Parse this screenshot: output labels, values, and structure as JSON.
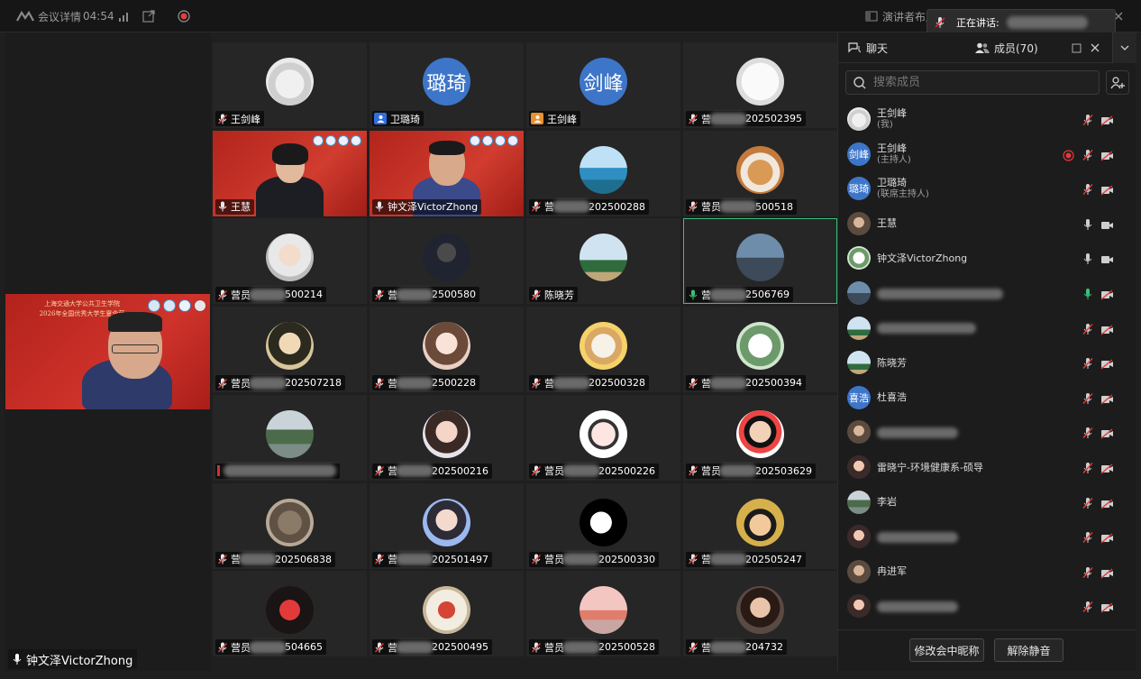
{
  "topbar": {
    "meeting_details": "会议详情",
    "timer": "04:54",
    "layout_label": "演讲者布局"
  },
  "speaking": {
    "label": "正在讲话:"
  },
  "main_video": {
    "name": "钟文泽VictorZhong",
    "slide_title_1": "上海交通大学公共卫生学院",
    "slide_title_2": "2026年全国优秀大学生夏令营"
  },
  "grid": [
    {
      "name": "王剑峰",
      "name_prefix": "",
      "name_suffix": "",
      "avatar_text": "",
      "avatar": "drawing",
      "mic": "muted"
    },
    {
      "name": "卫璐琦",
      "name_prefix": "",
      "name_suffix": "",
      "avatar_text": "璐琦",
      "avatar": "blue",
      "mic": "badge-blue"
    },
    {
      "name": "王剑峰",
      "name_prefix": "",
      "name_suffix": "",
      "avatar_text": "剑峰",
      "avatar": "blue",
      "mic": "badge-orange"
    },
    {
      "name": "",
      "name_prefix": "营",
      "name_suffix": "202502395",
      "avatar_text": "",
      "avatar": "sketch",
      "mic": "muted"
    },
    {
      "name": "王慧",
      "name_prefix": "",
      "name_suffix": "",
      "avatar_text": "",
      "avatar": "video",
      "mic": "on"
    },
    {
      "name": "钟文泽VictorZhong",
      "name_prefix": "",
      "name_suffix": "",
      "avatar_text": "",
      "avatar": "video",
      "mic": "on"
    },
    {
      "name": "",
      "name_prefix": "营",
      "name_suffix": "202500288",
      "avatar_text": "",
      "avatar": "sea",
      "mic": "muted"
    },
    {
      "name": "",
      "name_prefix": "营员",
      "name_suffix": "500518",
      "avatar_text": "",
      "avatar": "dog",
      "mic": "muted"
    },
    {
      "name": "",
      "name_prefix": "营员",
      "name_suffix": "500214",
      "avatar_text": "",
      "avatar": "girl",
      "mic": "muted"
    },
    {
      "name": "",
      "name_prefix": "营",
      "name_suffix": "2500580",
      "avatar_text": "",
      "avatar": "dark",
      "mic": "muted"
    },
    {
      "name": "陈晓芳",
      "name_prefix": "",
      "name_suffix": "",
      "avatar_text": "",
      "avatar": "palm",
      "mic": "muted"
    },
    {
      "name": "",
      "name_prefix": "营",
      "name_suffix": "2506769",
      "avatar_text": "",
      "avatar": "bridge",
      "mic": "on-green"
    },
    {
      "name": "",
      "name_prefix": "营员",
      "name_suffix": "202507218",
      "avatar_text": "",
      "avatar": "anime",
      "mic": "muted"
    },
    {
      "name": "",
      "name_prefix": "营",
      "name_suffix": "2500228",
      "avatar_text": "",
      "avatar": "anime2",
      "mic": "muted"
    },
    {
      "name": "",
      "name_prefix": "营",
      "name_suffix": "202500328",
      "avatar_text": "",
      "avatar": "puppy",
      "mic": "muted"
    },
    {
      "name": "",
      "name_prefix": "营",
      "name_suffix": "202500394",
      "avatar_text": "",
      "avatar": "cartoon",
      "mic": "muted"
    },
    {
      "name": "",
      "name_prefix": "",
      "name_suffix": "",
      "avatar_text": "",
      "avatar": "lake",
      "mic": "hidden"
    },
    {
      "name": "",
      "name_prefix": "营",
      "name_suffix": "202500216",
      "avatar_text": "",
      "avatar": "girl2",
      "mic": "muted"
    },
    {
      "name": "",
      "name_prefix": "营员",
      "name_suffix": "202500226",
      "avatar_text": "",
      "avatar": "grad",
      "mic": "muted"
    },
    {
      "name": "",
      "name_prefix": "营员",
      "name_suffix": "202503629",
      "avatar_text": "",
      "avatar": "melon",
      "mic": "muted"
    },
    {
      "name": "",
      "name_prefix": "营",
      "name_suffix": "202506838",
      "avatar_text": "",
      "avatar": "cat",
      "mic": "muted"
    },
    {
      "name": "",
      "name_prefix": "营",
      "name_suffix": "202501497",
      "avatar_text": "",
      "avatar": "girl3",
      "mic": "muted"
    },
    {
      "name": "",
      "name_prefix": "营员",
      "name_suffix": "202500330",
      "avatar_text": "",
      "avatar": "bw",
      "mic": "muted"
    },
    {
      "name": "",
      "name_prefix": "营",
      "name_suffix": "202505247",
      "avatar_text": "",
      "avatar": "luffy",
      "mic": "muted"
    },
    {
      "name": "",
      "name_prefix": "营员",
      "name_suffix": "504665",
      "avatar_text": "",
      "avatar": "red",
      "mic": "muted"
    },
    {
      "name": "",
      "name_prefix": "营",
      "name_suffix": "202500495",
      "avatar_text": "",
      "avatar": "mascot",
      "mic": "muted"
    },
    {
      "name": "",
      "name_prefix": "营员",
      "name_suffix": "202500528",
      "avatar_text": "",
      "avatar": "sunset",
      "mic": "muted"
    },
    {
      "name": "",
      "name_prefix": "营",
      "name_suffix": "204732",
      "avatar_text": "",
      "avatar": "woman",
      "mic": "muted"
    }
  ],
  "sidebar": {
    "tab_chat": "聊天",
    "tab_members": "成员(70)",
    "search_placeholder": "搜索成员",
    "members": [
      {
        "name": "王剑峰",
        "role": "(我)",
        "avatar_text": "",
        "avatar": "drawing",
        "mic": "muted",
        "cam": "off"
      },
      {
        "name": "王剑峰",
        "role": "(主持人)",
        "avatar_text": "剑峰",
        "avatar": "blue",
        "mic": "muted",
        "cam": "off",
        "recording": true
      },
      {
        "name": "卫璐琦",
        "role": "(联席主持人)",
        "avatar_text": "璐琦",
        "avatar": "blue",
        "mic": "muted",
        "cam": "off"
      },
      {
        "name": "王慧",
        "role": "",
        "avatar_text": "",
        "avatar": "photo",
        "mic": "on",
        "cam": "on"
      },
      {
        "name": "钟文泽VictorZhong",
        "role": "",
        "avatar_text": "",
        "avatar": "cartoon",
        "mic": "on",
        "cam": "on"
      },
      {
        "name": "",
        "role": "",
        "avatar_text": "",
        "avatar": "bridge",
        "mic": "on-green",
        "cam": "off"
      },
      {
        "name": "",
        "role": "",
        "avatar_text": "",
        "avatar": "palm",
        "mic": "muted",
        "cam": "off"
      },
      {
        "name": "陈晓芳",
        "role": "",
        "avatar_text": "",
        "avatar": "palm",
        "mic": "muted",
        "cam": "off"
      },
      {
        "name": "杜喜浩",
        "role": "",
        "avatar_text": "喜浩",
        "avatar": "blue",
        "mic": "muted",
        "cam": "off"
      },
      {
        "name": "",
        "role": "",
        "avatar_text": "",
        "avatar": "photo",
        "mic": "muted",
        "cam": "off"
      },
      {
        "name": "雷晓宁-环境健康系-硕导",
        "role": "",
        "avatar_text": "",
        "avatar": "photo2",
        "mic": "muted",
        "cam": "off"
      },
      {
        "name": "李岩",
        "role": "",
        "avatar_text": "",
        "avatar": "lake",
        "mic": "muted",
        "cam": "off"
      },
      {
        "name": "",
        "role": "",
        "avatar_text": "",
        "avatar": "photo2",
        "mic": "muted",
        "cam": "off"
      },
      {
        "name": "冉进军",
        "role": "",
        "avatar_text": "",
        "avatar": "photo",
        "mic": "muted",
        "cam": "off"
      },
      {
        "name": "",
        "role": "",
        "avatar_text": "",
        "avatar": "photo2",
        "mic": "muted",
        "cam": "off"
      }
    ],
    "btn_rename": "修改会中昵称",
    "btn_unmute": "解除静音"
  }
}
